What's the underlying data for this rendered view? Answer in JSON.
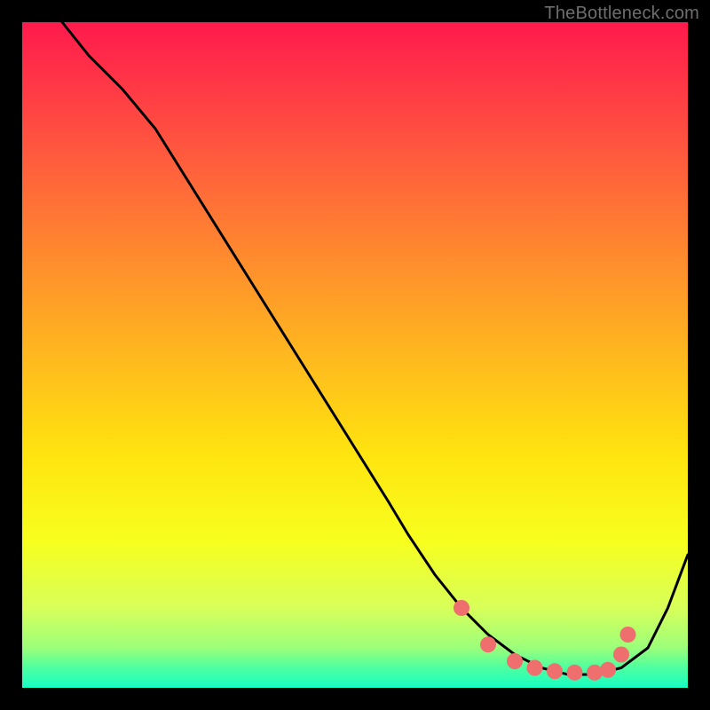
{
  "watermark": "TheBottleneck.com",
  "chart_data": {
    "type": "line",
    "title": "",
    "xlabel": "",
    "ylabel": "",
    "xlim": [
      0,
      100
    ],
    "ylim": [
      0,
      100
    ],
    "series": [
      {
        "name": "bottleneck-curve",
        "x": [
          6,
          10,
          15,
          20,
          25,
          30,
          35,
          40,
          45,
          50,
          55,
          58,
          62,
          66,
          70,
          74,
          78,
          82,
          86,
          90,
          94,
          97,
          100
        ],
        "values": [
          100,
          95,
          90,
          84,
          76,
          68,
          60,
          52,
          44,
          36,
          28,
          23,
          17,
          12,
          8,
          5,
          3,
          2,
          2,
          3,
          6,
          12,
          20
        ]
      }
    ],
    "markers": {
      "name": "highlight-dots",
      "x": [
        66,
        70,
        74,
        77,
        80,
        83,
        86,
        88,
        90,
        91
      ],
      "values": [
        12,
        6.5,
        4,
        3,
        2.5,
        2.3,
        2.3,
        2.7,
        5,
        8
      ]
    },
    "colors": {
      "curve": "#000000",
      "markers": "#ef6e6e",
      "background_top": "#ff1a4d",
      "background_bottom": "#17ffc4"
    }
  }
}
